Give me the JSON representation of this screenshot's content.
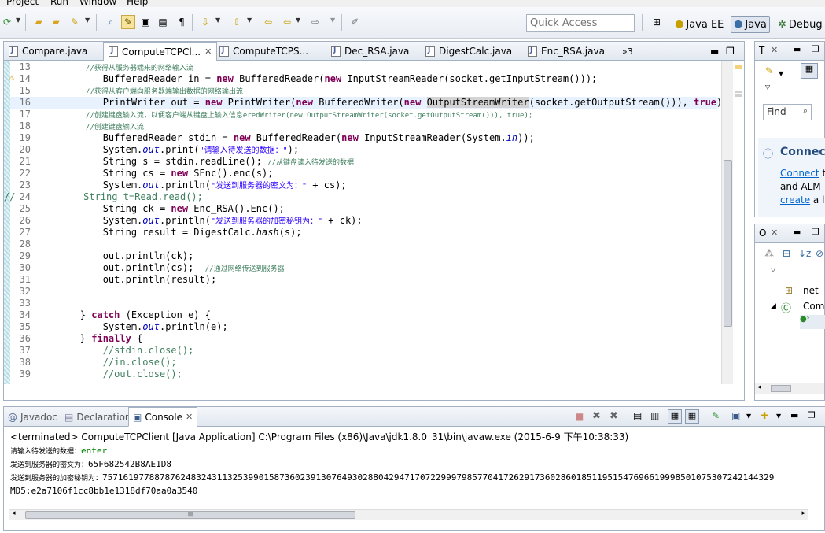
{
  "menu": [
    "Project",
    "Run",
    "Window",
    "Help"
  ],
  "toolbar": {
    "quick_access_placeholder": "Quick Access",
    "perspectives": [
      "Java EE",
      "Java",
      "Debug"
    ]
  },
  "editor": {
    "tabs": [
      {
        "label": "Compare.java",
        "active": false
      },
      {
        "label": "ComputeTCPCl...",
        "active": true,
        "close": "✕"
      },
      {
        "label": "ComputeTCPS...",
        "active": false
      },
      {
        "label": "Dec_RSA.java",
        "active": false
      },
      {
        "label": "DigestCalc.java",
        "active": false
      },
      {
        "label": "Enc_RSA.java",
        "active": false
      }
    ],
    "overflow": "»3",
    "lines": [
      {
        "n": "13",
        "t": "            //获得从服务器端来的网络输入流",
        "kind": "comment"
      },
      {
        "n": "14",
        "t": "            BufferedReader in = new BufferedReader(new InputStreamReader(socket.getInputStream()));"
      },
      {
        "n": "15",
        "t": "            //获得从客户端向服务器端输出数据的网络输出流",
        "kind": "comment"
      },
      {
        "n": "16",
        "t": "            PrintWriter out = new PrintWriter(new BufferedWriter(new OutputStreamWriter(socket.getOutputStream())), true);",
        "hl": true
      },
      {
        "n": "17",
        "t": "            //创建键盘输入流，以便客户端从键盘上输入信息eredWriter(new OutputStreamWriter(socket.getOutputStream())), true);",
        "kind": "comment"
      },
      {
        "n": "18",
        "t": "            //创建键盘输入流",
        "kind": "comment"
      },
      {
        "n": "19",
        "t": "            BufferedReader stdin = new BufferedReader(new InputStreamReader(System.in));"
      },
      {
        "n": "20",
        "t": "            System.out.print(\"请输入待发送的数据：\");"
      },
      {
        "n": "21",
        "t": "            String s = stdin.readLine(); //从键盘读入待发送的数据"
      },
      {
        "n": "22",
        "t": "            String cs = new SEnc().enc(s);"
      },
      {
        "n": "23",
        "t": "            System.out.println(\"发送到服务器的密文为：\" + cs);"
      },
      {
        "n": "24",
        "t": "//            String t=Read.read();",
        "kind": "comment-full"
      },
      {
        "n": "25",
        "t": "            String ck = new Enc_RSA().Enc();"
      },
      {
        "n": "26",
        "t": "            System.out.println(\"发送到服务器的加密秘钥为：\" + ck);"
      },
      {
        "n": "27",
        "t": "            String result = DigestCalc.hash(s);"
      },
      {
        "n": "28",
        "t": ""
      },
      {
        "n": "29",
        "t": "            out.println(ck);"
      },
      {
        "n": "30",
        "t": "            out.println(cs);  //通过网络传送到服务器"
      },
      {
        "n": "31",
        "t": "            out.println(result);"
      },
      {
        "n": "32",
        "t": ""
      },
      {
        "n": "33",
        "t": ""
      },
      {
        "n": "34",
        "t": "        } catch (Exception e) {"
      },
      {
        "n": "35",
        "t": "            System.out.println(e);"
      },
      {
        "n": "36",
        "t": "        } finally {"
      },
      {
        "n": "37",
        "t": "            //stdin.close();",
        "kind": "comment-full"
      },
      {
        "n": "38",
        "t": "            //in.close();",
        "kind": "comment-full"
      },
      {
        "n": "39",
        "t": "            //out.close();",
        "kind": "comment-full"
      }
    ]
  },
  "task_panel": {
    "tab": "T",
    "find_label": "Find",
    "connect_title": "Connect",
    "connect_link": "Connect",
    "connect_text1": " t",
    "connect_text2": "and ALM",
    "connect_link2": "create",
    "connect_text3": " a lo"
  },
  "outline_panel": {
    "tab": "O",
    "items": [
      "net",
      "Com"
    ]
  },
  "console": {
    "tabs": [
      "Javadoc",
      "Declaration",
      "Console"
    ],
    "title": "<terminated> ComputeTCPClient [Java Application] C:\\Program Files (x86)\\Java\\jdk1.8.0_31\\bin\\javaw.exe (2015-6-9 下午10:38:33)",
    "prompt": "请输入待发送的数据：",
    "input": "enter",
    "cipher_label": "发送到服务器的密文为：",
    "cipher": "65F682542B8AE1D8",
    "key_label": "发送到服务器的加密秘钥为：",
    "key": "757161977887876248324311325399015873602391307649302880429471707229997985770417262917360286018511951547696619998501075307242144329",
    "md5": "MD5:e2a7106f1cc8bb1e1318df70aa0a3540"
  }
}
